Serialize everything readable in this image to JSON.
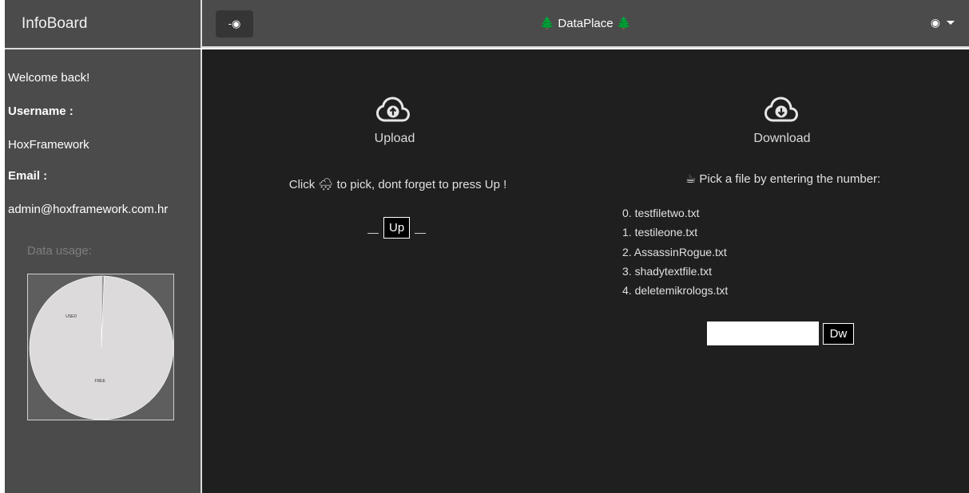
{
  "sidebar": {
    "brand": "InfoBoard",
    "welcome": "Welcome back!",
    "username_label": "Username :",
    "username": "HoxFramework",
    "email_label": "Email :",
    "email": "admin@hoxframework.com.hr",
    "usage_title": "Data usage:"
  },
  "chart_data": {
    "type": "pie",
    "title": "",
    "labels": [
      "USED",
      "FREE"
    ],
    "values": [
      0.6,
      99.4
    ],
    "colors": [
      "#9b9b9b",
      "#dcdada"
    ]
  },
  "header": {
    "toggle_label": "-◉",
    "title_left_icon": "🌲",
    "title": "DataPlace",
    "title_right_icon": "🌲",
    "user_menu_icon": "◉"
  },
  "upload": {
    "label": "Upload",
    "hint": "Click 🌨 to pick, dont forget to press Up !",
    "button": "Up"
  },
  "download": {
    "label": "Download",
    "hint": "☕ Pick a file by entering the number:",
    "files": [
      "0. testfiletwo.txt",
      "1. testileone.txt",
      "2. AssassinRogue.txt",
      "3. shadytextfile.txt",
      "4. deletemikrologs.txt"
    ],
    "input_value": "",
    "button": "Dw"
  },
  "colors": {
    "sidebar_bg": "#4b4b4b",
    "main_bg": "#1f1f1f",
    "accent_tree": "#55b14a"
  }
}
